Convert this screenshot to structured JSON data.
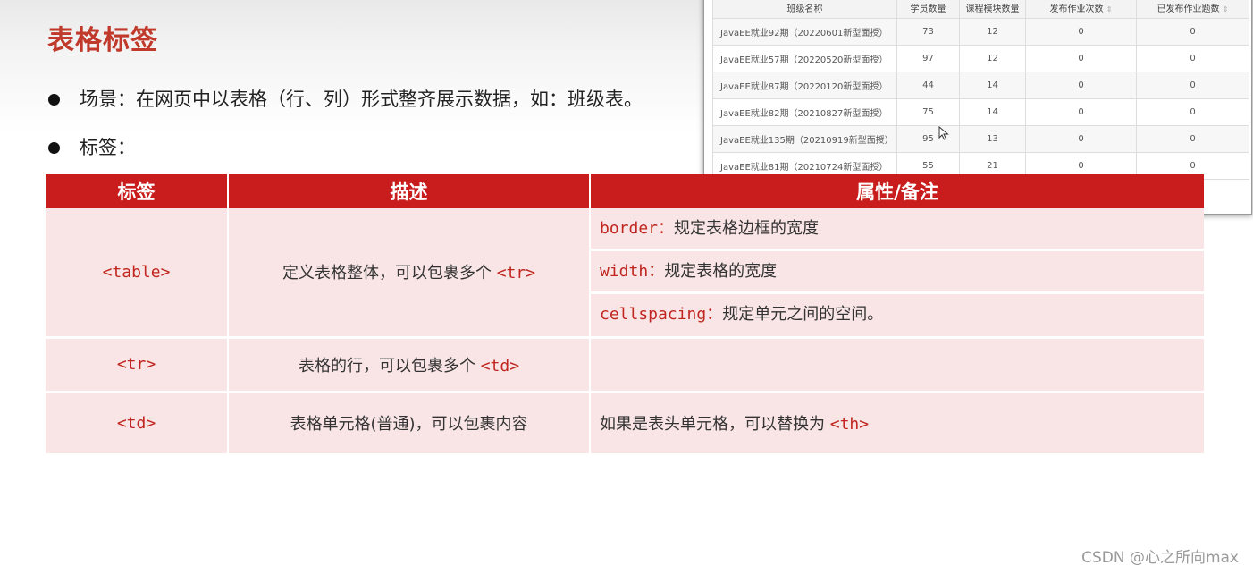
{
  "slide": {
    "title": "表格标签",
    "bullets": [
      "场景：在网页中以表格（行、列）形式整齐展示数据，如：班级表。",
      "标签："
    ]
  },
  "main_table": {
    "headers": [
      "标签",
      "描述",
      "属性/备注"
    ],
    "rows": [
      {
        "tag": "<table>",
        "desc_text": "定义表格整体，可以包裹多个",
        "desc_code": "<tr>",
        "attrs": [
          {
            "name": "border",
            "sep": "：",
            "text": "规定表格边框的宽度"
          },
          {
            "name": "width",
            "sep": "：",
            "text": "规定表格的宽度"
          },
          {
            "name": "cellspacing",
            "sep": "：",
            "text": "规定单元之间的空间。"
          }
        ]
      },
      {
        "tag": "<tr>",
        "desc_text": "表格的行，可以包裹多个",
        "desc_code": "<td>",
        "note": ""
      },
      {
        "tag": "<td>",
        "desc_text": "表格单元格(普通)，可以包裹内容",
        "note_text": "如果是表头单元格，可以替换为",
        "note_code": "<th>"
      }
    ]
  },
  "inset_table": {
    "headers": [
      "班级名称",
      "学员数量",
      "课程模块数量",
      "发布作业次数",
      "已发布作业题数"
    ],
    "sort_glyph": "⇕",
    "rows": [
      [
        "JavaEE就业92期（20220601新型面授）",
        "73",
        "12",
        "0",
        "0"
      ],
      [
        "JavaEE就业57期（20220520新型面授）",
        "97",
        "12",
        "0",
        "0"
      ],
      [
        "JavaEE就业87期（20220120新型面授）",
        "44",
        "14",
        "0",
        "0"
      ],
      [
        "JavaEE就业82期（20210827新型面授）",
        "75",
        "14",
        "0",
        "0"
      ],
      [
        "JavaEE就业135期（20210919新型面授）",
        "95",
        "13",
        "0",
        "0"
      ],
      [
        "JavaEE就业81期（20210724新型面授）",
        "55",
        "21",
        "0",
        "0"
      ]
    ]
  },
  "watermark": "CSDN @心之所向max",
  "colors": {
    "accent": "#c91c1c",
    "title": "#c0392b",
    "code": "#c0261f",
    "row_bg": "#f9e5e5"
  }
}
